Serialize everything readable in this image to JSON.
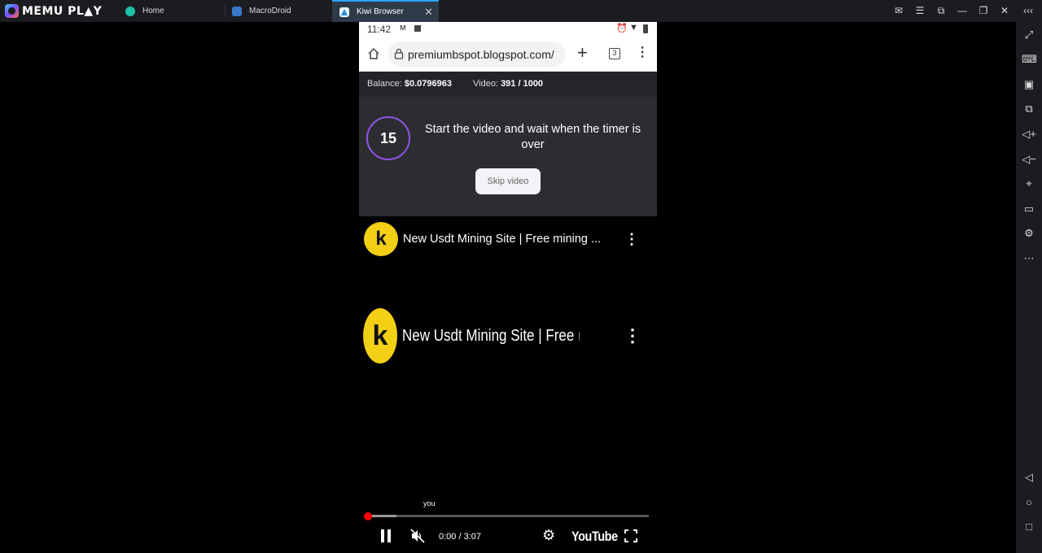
{
  "app": {
    "brand": "MEMU PL▲Y",
    "tabs": [
      {
        "label": "Home",
        "icon": "home-app-icon"
      },
      {
        "label": "MacroDroid",
        "icon": "macrodroid-icon"
      },
      {
        "label": "Kiwi Browser",
        "icon": "kiwi-icon",
        "active": true
      }
    ]
  },
  "statusbar": {
    "time": "11:42"
  },
  "browser": {
    "url": "premiumbspot.blogspot.com/",
    "tab_count": "3"
  },
  "infobar": {
    "balance_label": "Balance:",
    "balance_value": "$0.0796963",
    "video_label": "Video:",
    "video_value": "391 / 1000"
  },
  "panel": {
    "timer": "15",
    "message": "Start the video and wait when the timer is over",
    "skip_label": "Skip video"
  },
  "video": {
    "title": "New Usdt Mining Site | Free mining ...",
    "channel_letter": "k",
    "caption": "you",
    "time": "0:00 / 3:07",
    "brand": "YouTube",
    "progress": 0.0
  },
  "colors": {
    "accent": "#2aa4ff",
    "timer_ring": "#8e55e6",
    "channel": "#f3cf16",
    "progress": "#ff0000"
  }
}
